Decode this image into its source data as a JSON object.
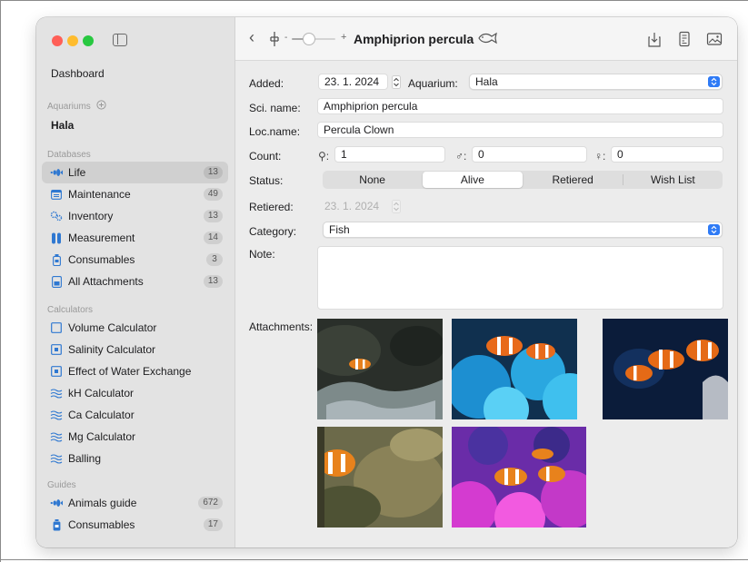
{
  "sidebar": {
    "dashboard": "Dashboard",
    "aquariums_header": "Aquariums",
    "aquarium": "Hala",
    "databases_header": "Databases",
    "databases": [
      {
        "label": "Life",
        "count": "13",
        "icon": "fish-school-icon"
      },
      {
        "label": "Maintenance",
        "count": "49",
        "icon": "calendar-icon"
      },
      {
        "label": "Inventory",
        "count": "13",
        "icon": "gears-icon"
      },
      {
        "label": "Measurement",
        "count": "14",
        "icon": "test-tubes-icon"
      },
      {
        "label": "Consumables",
        "count": "3",
        "icon": "bottle-icon"
      },
      {
        "label": "All Attachments",
        "count": "13",
        "icon": "attachment-icon"
      }
    ],
    "calculators_header": "Calculators",
    "calculators": [
      {
        "label": "Volume Calculator",
        "icon": "square-icon"
      },
      {
        "label": "Salinity Calculator",
        "icon": "dot-square-icon"
      },
      {
        "label": "Effect of Water Exchange",
        "icon": "dot-square-icon"
      },
      {
        "label": "kH Calculator",
        "icon": "waves-icon"
      },
      {
        "label": "Ca Calculator",
        "icon": "waves-icon"
      },
      {
        "label": "Mg Calculator",
        "icon": "waves-icon"
      },
      {
        "label": "Balling",
        "icon": "waves-icon"
      }
    ],
    "guides_header": "Guides",
    "guides": [
      {
        "label": "Animals guide",
        "count": "672",
        "icon": "fish-school-icon"
      },
      {
        "label": "Consumables",
        "count": "17",
        "icon": "bottle-icon"
      }
    ]
  },
  "toolbar": {
    "back": "‹",
    "slider_minus": "-",
    "slider_plus": "+",
    "title": "Amphiprion percula"
  },
  "form": {
    "added_label": "Added:",
    "added_value": "23.  1. 2024",
    "aquarium_label": "Aquarium:",
    "aquarium_value": "Hala",
    "sci_label": "Sci. name:",
    "sci_value": "Amphiprion percula",
    "loc_label": "Loc.name:",
    "loc_value": "Percula Clown",
    "count_label": "Count:",
    "count_unsexed_symbol": "⚲:",
    "count_unsexed": "1",
    "count_male_symbol": "♂:",
    "count_male": "0",
    "count_female_symbol": "♀:",
    "count_female": "0",
    "status_label": "Status:",
    "status_options": [
      "None",
      "Alive",
      "Retiered",
      "Wish List"
    ],
    "status_selected": "Alive",
    "retiered_label": "Retiered:",
    "retiered_value": "23.  1. 2024",
    "category_label": "Category:",
    "category_value": "Fish",
    "note_label": "Note:",
    "note_value": "",
    "attachments_label": "Attachments:"
  },
  "attachments_count": 5,
  "colors": {
    "accent": "#2f7bf6",
    "sidebar_bg": "#e3e3e3",
    "life_icon": "#2f78d1"
  }
}
